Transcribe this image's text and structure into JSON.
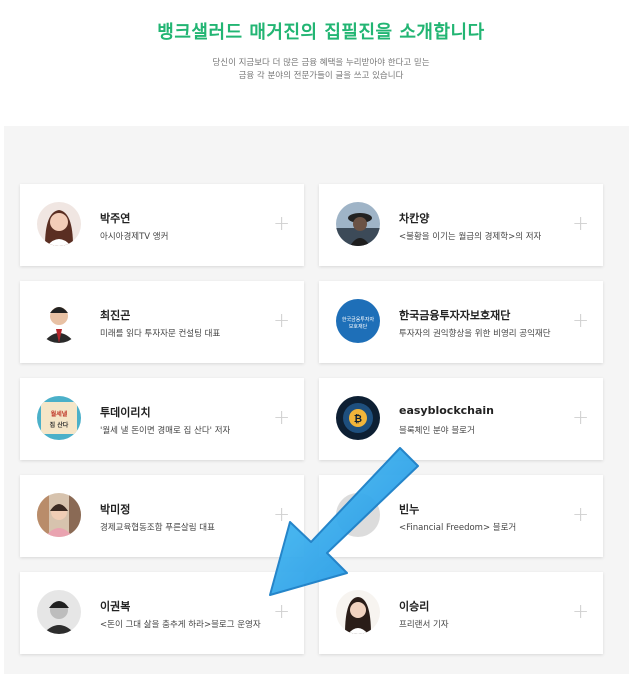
{
  "header": {
    "title": "뱅크샐러드 매거진의 집필진을 소개합니다",
    "subtitle_line1": "당신이 지금보다 더 많은 금융 혜택을 누리받아야 한다고 믿는",
    "subtitle_line2": "금융 각 분야의 전문가들이 글을 쓰고 있습니다"
  },
  "authors": [
    {
      "name": "박주연",
      "desc": "아시아경제TV 앵커",
      "avatar": "woman-portrait"
    },
    {
      "name": "차칸양",
      "desc": "<불황을 이기는 월급의 경제학>의 저자",
      "avatar": "man-hat-portrait"
    },
    {
      "name": "최진곤",
      "desc": "미래를 읽다 투자자문 컨설팅 대표",
      "avatar": "man-suit-portrait"
    },
    {
      "name": "한국금융투자자보호재단",
      "desc": "투자자의 권익향상을 위한 비영리 공익재단",
      "avatar": "foundation-logo",
      "logo_line1": "한국금융투자자",
      "logo_line2": "보호재단"
    },
    {
      "name": "투데이리치",
      "desc": "'월세 낼 돈이면 경매로 집 산다' 저자",
      "avatar": "book-cover",
      "logo_line1": "월세낼",
      "logo_line2": "집 산다"
    },
    {
      "name": "easyblockchain",
      "desc": "블록체인 분야 블로거",
      "avatar": "blockchain-coin"
    },
    {
      "name": "박미정",
      "desc": "경제교육협동조합 푸른살림 대표",
      "avatar": "woman-bookshelf-portrait"
    },
    {
      "name": "빈누",
      "desc": "<Financial Freedom> 블로거",
      "avatar": "hidden"
    },
    {
      "name": "이권복",
      "desc": "<돈이 그대 삶을 춤추게 하라>블로그 운영자",
      "avatar": "man-bw-portrait"
    },
    {
      "name": "이승리",
      "desc": "프리랜서 기자",
      "avatar": "woman-longhair-portrait"
    }
  ],
  "plus_symbol": "+",
  "colors": {
    "accent": "#22b573",
    "arrow": "#29a9ea"
  }
}
